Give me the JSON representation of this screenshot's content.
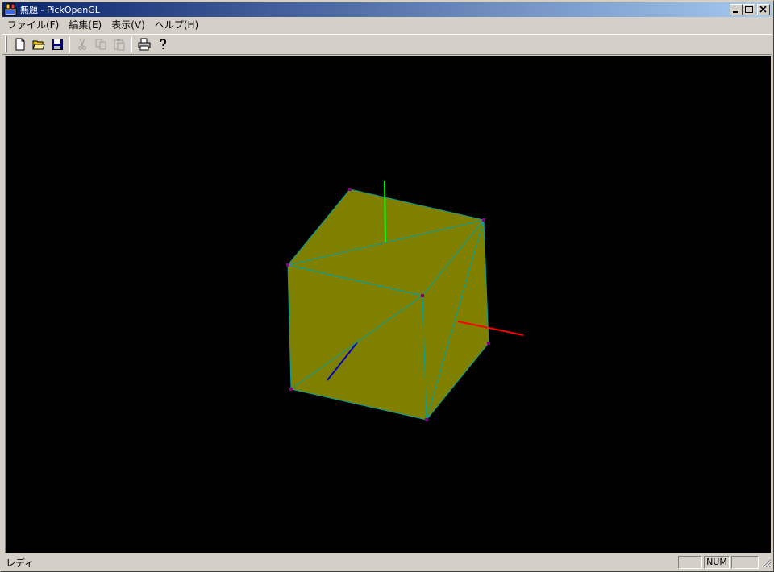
{
  "window": {
    "title": "無題 - PickOpenGL"
  },
  "menu": [
    {
      "id": "file",
      "label": "ファイル(F)"
    },
    {
      "id": "edit",
      "label": "編集(E)"
    },
    {
      "id": "view",
      "label": "表示(V)"
    },
    {
      "id": "help",
      "label": "ヘルプ(H)"
    }
  ],
  "toolbar": {
    "icons": [
      "new-file-icon",
      "open-folder-icon",
      "save-disk-icon",
      "cut-scissors-icon",
      "copy-icon",
      "paste-icon",
      "print-icon",
      "help-question-icon"
    ],
    "disabled": [
      "cut",
      "copy",
      "paste"
    ]
  },
  "viewport": {
    "background": "#000000",
    "cube_face_color": "#808000",
    "edge_color": "#00a0a0",
    "vertex_color": "#800080",
    "axis_colors": {
      "x": "#ff0000",
      "y": "#00ff00",
      "z": "#0000c0"
    }
  },
  "status": {
    "text": "レディ",
    "indicators": [
      "",
      "NUM",
      ""
    ]
  },
  "colors": {
    "title_gradient_start": "#0a246a",
    "title_gradient_end": "#a6caf0",
    "face": "#d4d0c8"
  }
}
